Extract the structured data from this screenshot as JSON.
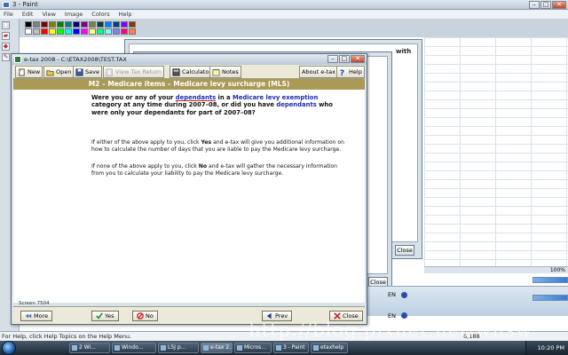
{
  "paint": {
    "title": "3 - Paint",
    "menu": [
      "File",
      "Edit",
      "View",
      "Image",
      "Colors",
      "Help"
    ],
    "palette_colors": [
      "#000000",
      "#808080",
      "#800000",
      "#808000",
      "#008000",
      "#008080",
      "#000080",
      "#800080",
      "#808040",
      "#004040",
      "#0080ff",
      "#004080",
      "#8000ff",
      "#804000",
      "#ffffff",
      "#c0c0c0",
      "#ff0000",
      "#ffff00",
      "#00ff00",
      "#00ffff",
      "#0000ff",
      "#ff00ff",
      "#ffff80",
      "#00ff80",
      "#80ffff",
      "#8080ff",
      "#ff0080",
      "#ff8040"
    ]
  },
  "background_windows": {
    "with_text": "with",
    "close_label": "Close",
    "zoom": "100%",
    "lang_label": "EN"
  },
  "etax": {
    "title": "e-tax 2008 - C:\\ETAX2008\\TEST.TAX",
    "toolbar": {
      "new": "New",
      "open": "Open",
      "save": "Save",
      "view_tax_return": "View Tax Return",
      "calculator": "Calculator",
      "notes": "Notes",
      "about": "About e-tax",
      "help": "Help"
    },
    "header": "M2 – Medicare items – Medicare levy surcharge (MLS)",
    "question": {
      "p1": "Were you or any of your ",
      "w1": "dependants",
      "p2": " in a ",
      "w2": "Medicare levy exemption",
      "p3": " category at any time during 2007–08, or did you have ",
      "w3": "dependants",
      "p4": " who were only your dependants for part of 2007–08?"
    },
    "para1": {
      "a": "If either of the above apply to you, click ",
      "b": "Yes",
      "c": " and e-tax will give you additional information on how to calculate the number of days that you are liable to pay the Medicare levy surcharge."
    },
    "para2": {
      "a": "If none of the above apply to you, click ",
      "b": "No",
      "c": " and e-tax will gather the necessary information from you to calculate your liability to pay the Medicare levy surcharge."
    },
    "screen_number": "Screen 7504",
    "buttons": {
      "more": "More",
      "yes": "Yes",
      "no": "No",
      "prev": "Prev",
      "close": "Close"
    }
  },
  "status": {
    "help_text": "For Help, click Help Topics on the Help Menu.",
    "position": "6,188"
  },
  "taskbar": {
    "items": [
      "2 Wi...",
      "Windo...",
      "L5J p...",
      "e-tax 2...",
      "Micros...",
      "3 - Paint",
      "etaxhelp"
    ],
    "clock": "10:20 PM"
  },
  "watermark": "http://blog.pixnet.net/wnsw"
}
